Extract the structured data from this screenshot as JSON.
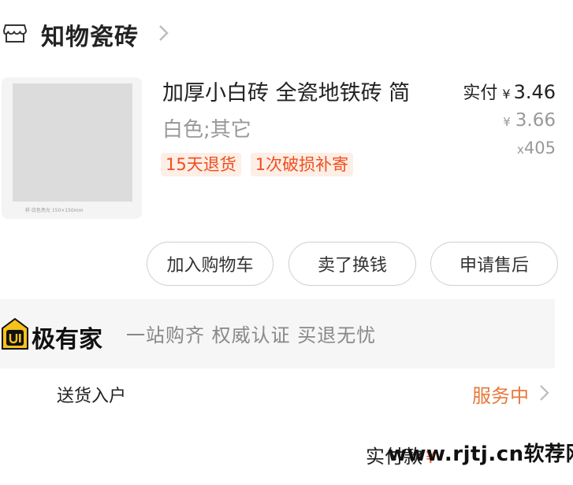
{
  "store": {
    "name": "知物瓷砖"
  },
  "product": {
    "title": "加厚小白砖 全瓷地铁砖 简",
    "variant": "白色;其它",
    "image_caption": "样·白色亮光   150×150mm",
    "tags": [
      "15天退货",
      "1次破损补寄"
    ],
    "paid_label": "实付",
    "currency": "¥",
    "paid_amount": "3.46",
    "original_amount": "3.66",
    "quantity_prefix": "x",
    "quantity": "405"
  },
  "actions": {
    "add_to_cart": "加入购物车",
    "resell": "卖了换钱",
    "after_sale": "申请售后"
  },
  "banner": {
    "logo_text": "极有家",
    "slogan": "一站购齐 权威认证 买退无忧"
  },
  "delivery": {
    "label": "送货入户",
    "status": "服务中"
  },
  "footer": {
    "total_label": "实付款",
    "currency": "¥",
    "watermark": "www.rjtj.cn软荐网"
  },
  "colors": {
    "accent": "#f04f1e",
    "service_orange": "#e8783c",
    "muted": "#999999"
  }
}
